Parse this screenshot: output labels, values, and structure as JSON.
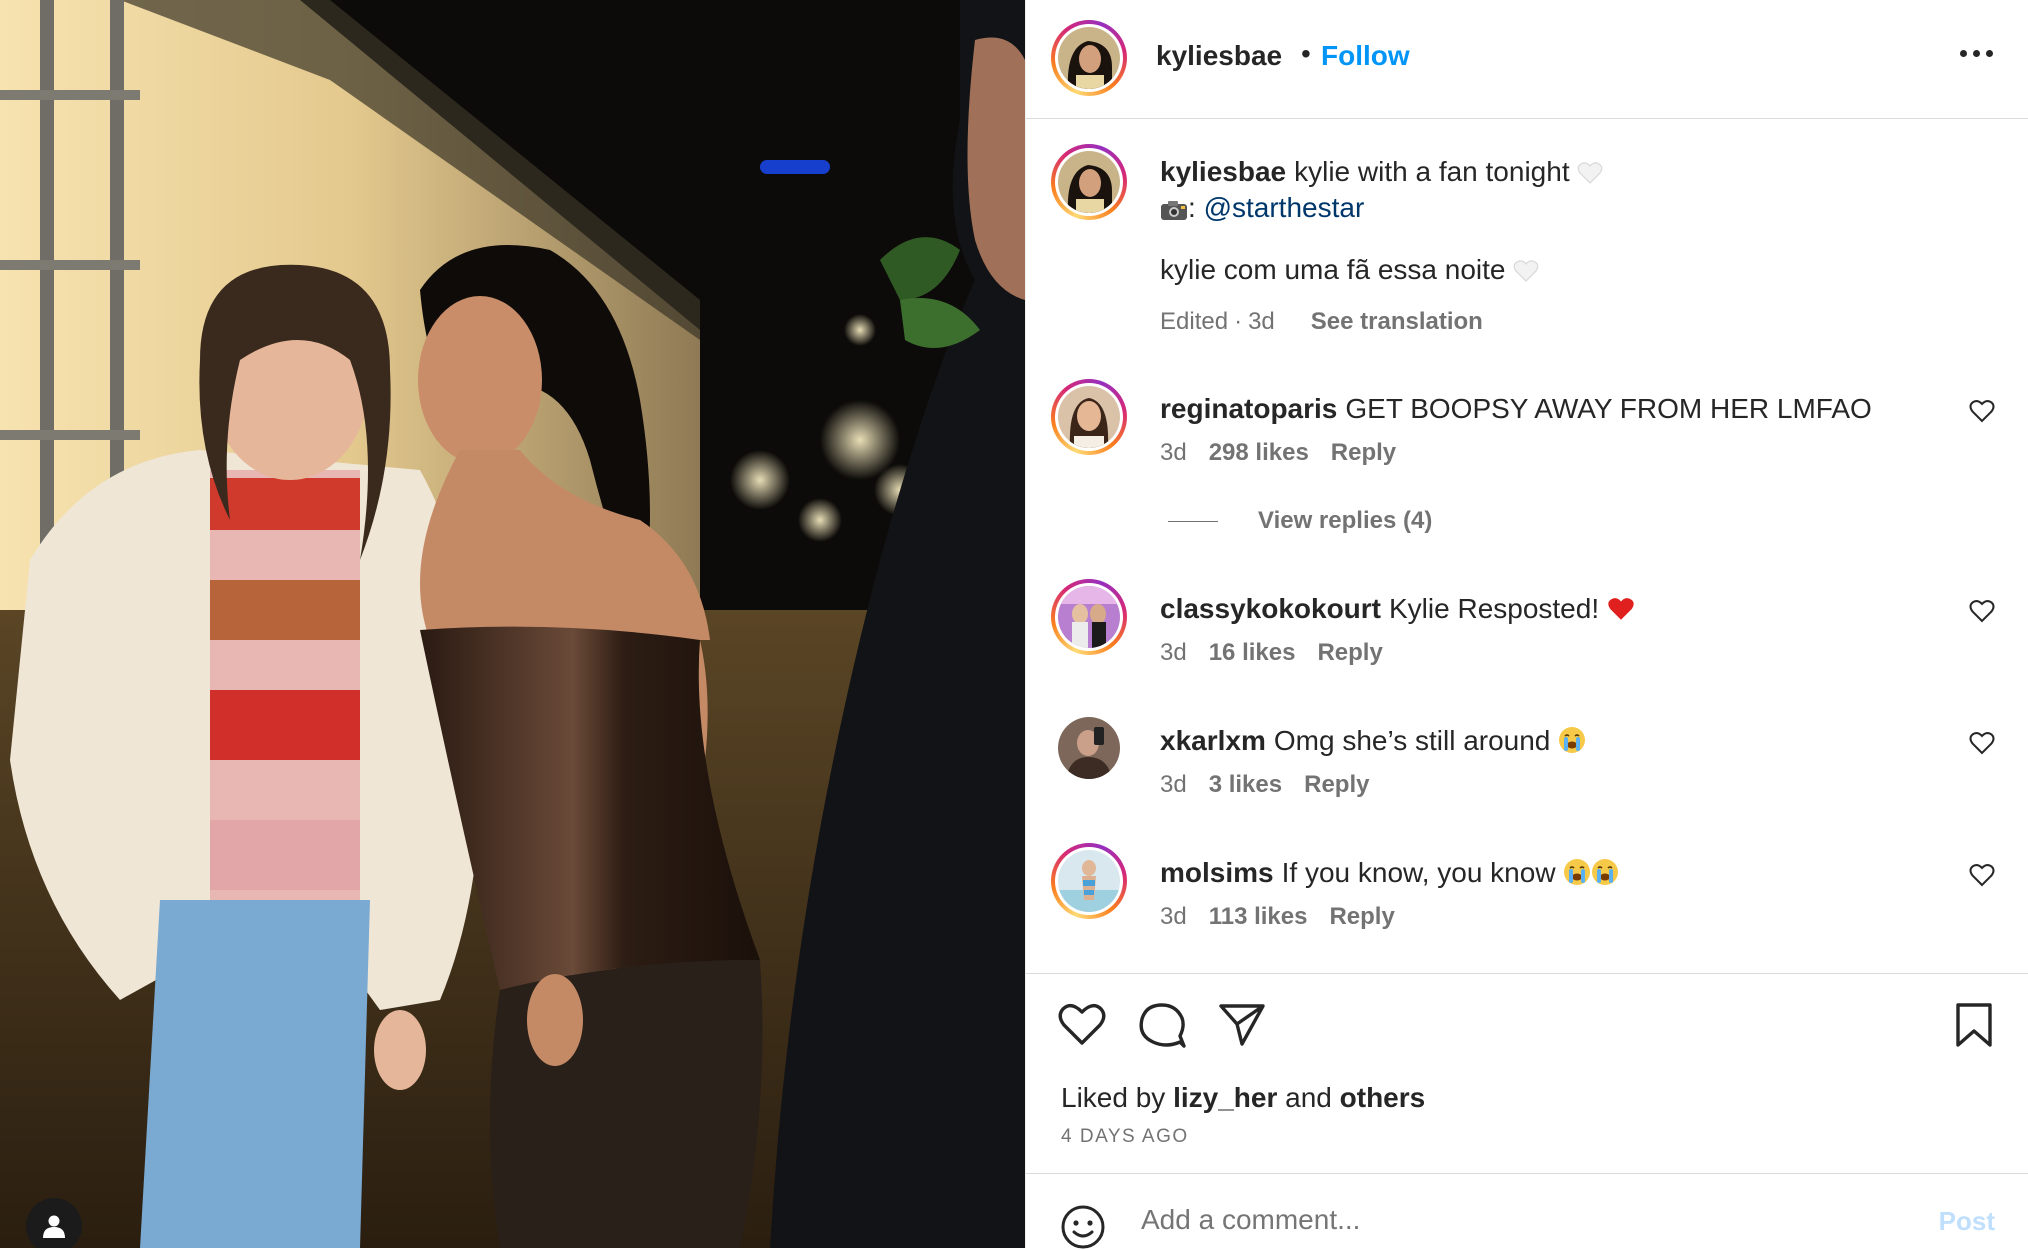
{
  "post": {
    "author": "kyliesbae",
    "follow_label": "Follow",
    "separator": "•",
    "caption_text": "kylie with a fan tonight",
    "caption_credit_prefix": ":",
    "caption_mention": "@starthestar",
    "caption_translation": "kylie com uma fã essa noite",
    "edited_label": "Edited",
    "meta_dot": "·",
    "caption_age": "3d",
    "see_translation": "See translation"
  },
  "comments": [
    {
      "user": "reginatoparis",
      "text": "GET BOOPSY AWAY FROM HER LMFAO",
      "age": "3d",
      "likes": "298 likes",
      "reply": "Reply",
      "view_replies": "View replies (4)"
    },
    {
      "user": "classykokokourt",
      "text": "Kylie Resposted!",
      "age": "3d",
      "likes": "16 likes",
      "reply": "Reply"
    },
    {
      "user": "xkarlxm",
      "text": "Omg she’s still around",
      "age": "3d",
      "likes": "3 likes",
      "reply": "Reply"
    },
    {
      "user": "molsims",
      "text": "If you know, you know",
      "age": "3d",
      "likes": "113 likes",
      "reply": "Reply"
    }
  ],
  "engagement": {
    "liked_by_prefix": "Liked by",
    "liked_by_user": "lizy_her",
    "liked_by_mid": "and",
    "liked_by_others": "others",
    "timestamp": "4 DAYS AGO"
  },
  "composer": {
    "placeholder": "Add a comment...",
    "post_label": "Post"
  },
  "icons": {
    "header_more": "more-options-icon",
    "like": "heart-icon",
    "comment": "comment-icon",
    "share": "share-icon",
    "save": "bookmark-icon",
    "emoji": "emoji-icon",
    "tags": "user-tag-icon"
  },
  "colors": {
    "follow": "#0095f6",
    "mention": "#00376b",
    "muted": "#737373",
    "post_disabled": "#c0dffd"
  }
}
